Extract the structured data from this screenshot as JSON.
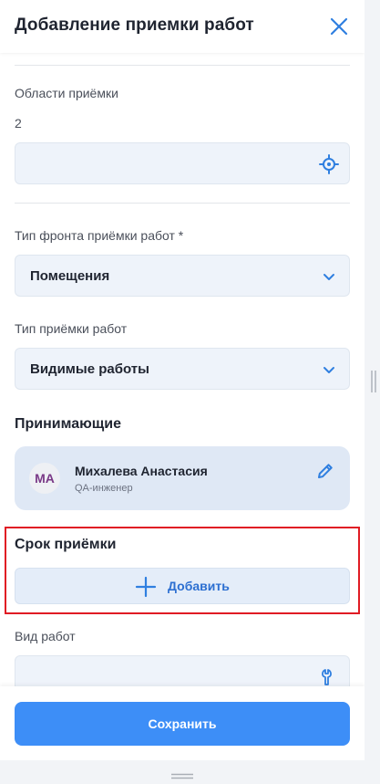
{
  "header": {
    "title": "Добавление приемки работ",
    "close_icon": "close-icon"
  },
  "areas": {
    "label": "Области приёмки",
    "count": "2",
    "field_icon": "crosshair-location-icon",
    "value": ""
  },
  "front_type": {
    "label": "Тип фронта приёмки работ *",
    "selected": "Помещения",
    "icon": "chevron-down-icon"
  },
  "acceptance_type": {
    "label": "Тип приёмки работ",
    "selected": "Видимые работы",
    "icon": "chevron-down-icon"
  },
  "acceptors": {
    "title": "Принимающие",
    "person": {
      "initials": "МА",
      "name": "Михалева Анастасия",
      "role": "QA-инженер",
      "icon": "pencil-edit-icon"
    }
  },
  "deadline": {
    "title": "Срок приёмки",
    "add_label": "Добавить",
    "add_icon": "plus-icon"
  },
  "work_type": {
    "label": "Вид работ",
    "field_icon": "wrench-icon",
    "value": ""
  },
  "footer": {
    "save_label": "Сохранить"
  },
  "colors": {
    "accent": "#3d8ef7",
    "field_bg": "#eef3fa",
    "card_bg": "#dfe8f5",
    "highlight": "#e01b24",
    "avatar_text": "#7a3a87"
  }
}
